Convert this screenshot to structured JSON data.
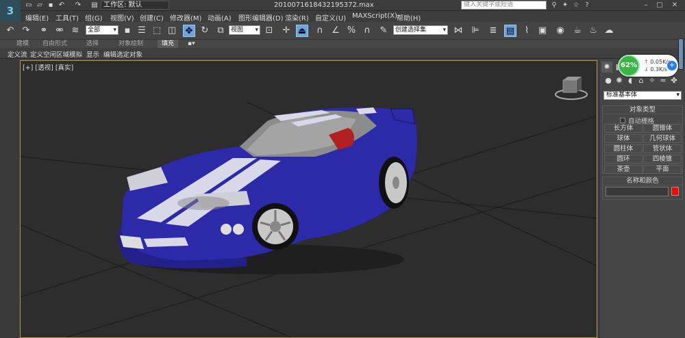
{
  "app": {
    "logo": "3",
    "workspace_label": "工作区: 默认",
    "doc_title": "20100716184321953​72.max",
    "search_placeholder": "键入关键字或短语"
  },
  "menu": [
    "编辑(E)",
    "工具(T)",
    "组(G)",
    "视图(V)",
    "创建(C)",
    "修改器(M)",
    "动画(A)",
    "图形编辑器(D)",
    "渲染(R)",
    "自定义(U)",
    "MAXScript(X)",
    "帮助(H)"
  ],
  "toolbar": {
    "selection_filter": "全部",
    "ref_coord": "视图",
    "named_selection": "创建选择集"
  },
  "ribbon": {
    "tabs": [
      "建模",
      "自由形式",
      "选择",
      "对象绘制",
      "填充"
    ],
    "active": "填充"
  },
  "subbar": {
    "items": [
      "定义流",
      "定义空闲区域",
      "模拟",
      "显示",
      "编辑选定对象"
    ]
  },
  "viewport": {
    "label": "[+] [透视] [真实]",
    "border_color": "#b89a43"
  },
  "command_panel": {
    "category": "标准基本体",
    "object_type_title": "对象类型",
    "autogrid_label": "自动栅格",
    "buttons": [
      "长方体",
      "圆锥体",
      "球体",
      "几何球体",
      "圆柱体",
      "管状体",
      "圆环",
      "四棱锥",
      "茶壶",
      "平面"
    ],
    "name_color_title": "名称和颜色",
    "object_color": "#ff0000"
  },
  "net_meter": {
    "percent": "62%",
    "up": "0.05K/s",
    "down": "0.3K/s"
  }
}
